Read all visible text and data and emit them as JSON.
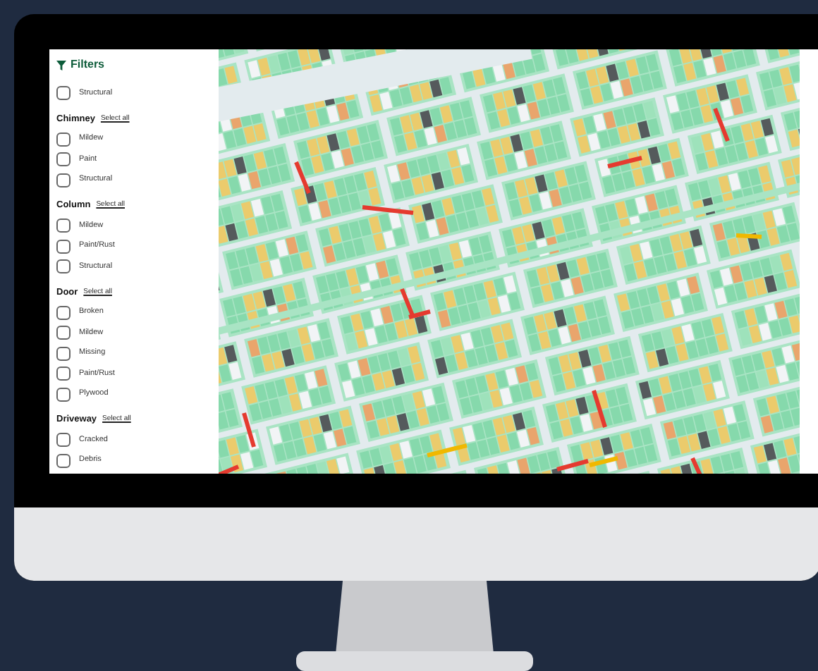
{
  "sidebar": {
    "title": "Filters",
    "groups": [
      {
        "items": [
          {
            "label": "Structural",
            "checked": false
          }
        ]
      },
      {
        "title": "Chimney",
        "link": "Select all",
        "items": [
          {
            "label": "Mildew",
            "checked": false
          },
          {
            "label": "Paint",
            "checked": false
          },
          {
            "label": "Structural",
            "checked": false
          }
        ]
      },
      {
        "title": "Column",
        "link": "Select all",
        "items": [
          {
            "label": "Mildew",
            "checked": false
          },
          {
            "label": "Paint/Rust",
            "checked": false
          },
          {
            "label": "Structural",
            "checked": false
          }
        ]
      },
      {
        "title": "Door",
        "link": "Select all",
        "items": [
          {
            "label": "Broken",
            "checked": false
          },
          {
            "label": "Mildew",
            "checked": false
          },
          {
            "label": "Missing",
            "checked": false
          },
          {
            "label": "Paint/Rust",
            "checked": false
          },
          {
            "label": "Plywood",
            "checked": false
          }
        ]
      },
      {
        "title": "Driveway",
        "link": "Select all",
        "items": [
          {
            "label": "Cracked",
            "checked": false
          },
          {
            "label": "Debris",
            "checked": false
          }
        ]
      }
    ]
  }
}
